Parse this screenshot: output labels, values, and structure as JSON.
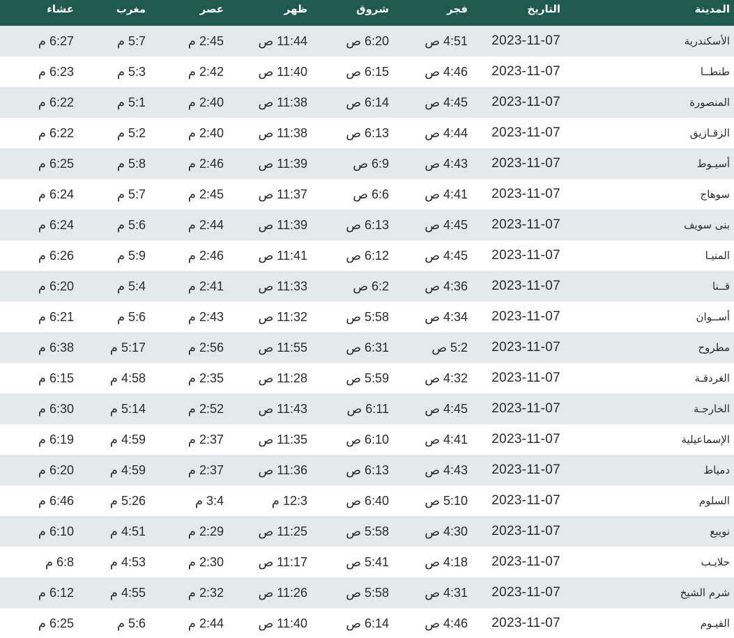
{
  "table": {
    "headers": {
      "city": "المدينة",
      "date": "التاريخ",
      "fajr": "فجر",
      "sunrise": "شروق",
      "dhuhr": "ظهر",
      "asr": "عصر",
      "maghrib": "مغرب",
      "isha": "عشاء"
    },
    "rows": [
      {
        "city": "الأسكندرية",
        "date": "2023-11-07",
        "fajr": "4:51 ص",
        "sunrise": "6:20 ص",
        "dhuhr": "11:44 ص",
        "asr": "2:45 م",
        "maghrib": "5:7 م",
        "isha": "6:27 م"
      },
      {
        "city": "طنطــا",
        "date": "2023-11-07",
        "fajr": "4:46 ص",
        "sunrise": "6:15 ص",
        "dhuhr": "11:40 ص",
        "asr": "2:42 م",
        "maghrib": "5:3 م",
        "isha": "6:23 م"
      },
      {
        "city": "المنصورة",
        "date": "2023-11-07",
        "fajr": "4:45 ص",
        "sunrise": "6:14 ص",
        "dhuhr": "11:38 ص",
        "asr": "2:40 م",
        "maghrib": "5:1 م",
        "isha": "6:22 م"
      },
      {
        "city": "الزقـازيق",
        "date": "2023-11-07",
        "fajr": "4:44 ص",
        "sunrise": "6:13 ص",
        "dhuhr": "11:38 ص",
        "asr": "2:40 م",
        "maghrib": "5:2 م",
        "isha": "6:22 م"
      },
      {
        "city": "أسيـوط",
        "date": "2023-11-07",
        "fajr": "4:43 ص",
        "sunrise": "6:9 ص",
        "dhuhr": "11:39 ص",
        "asr": "2:46 م",
        "maghrib": "5:8 م",
        "isha": "6:25 م"
      },
      {
        "city": "سوهاج",
        "date": "2023-11-07",
        "fajr": "4:41 ص",
        "sunrise": "6:6 ص",
        "dhuhr": "11:37 ص",
        "asr": "2:45 م",
        "maghrib": "5:7 م",
        "isha": "6:24 م"
      },
      {
        "city": "بنى سويف",
        "date": "2023-11-07",
        "fajr": "4:45 ص",
        "sunrise": "6:13 ص",
        "dhuhr": "11:39 ص",
        "asr": "2:44 م",
        "maghrib": "5:6 م",
        "isha": "6:24 م"
      },
      {
        "city": "المنيـا",
        "date": "2023-11-07",
        "fajr": "4:45 ص",
        "sunrise": "6:12 ص",
        "dhuhr": "11:41 ص",
        "asr": "2:46 م",
        "maghrib": "5:9 م",
        "isha": "6:26 م"
      },
      {
        "city": "قــنا",
        "date": "2023-11-07",
        "fajr": "4:36 ص",
        "sunrise": "6:2 ص",
        "dhuhr": "11:33 ص",
        "asr": "2:41 م",
        "maghrib": "5:4 م",
        "isha": "6:20 م"
      },
      {
        "city": "أســوان",
        "date": "2023-11-07",
        "fajr": "4:34 ص",
        "sunrise": "5:58 ص",
        "dhuhr": "11:32 ص",
        "asr": "2:43 م",
        "maghrib": "5:6 م",
        "isha": "6:21 م"
      },
      {
        "city": "مطروح",
        "date": "2023-11-07",
        "fajr": "5:2 ص",
        "sunrise": "6:31 ص",
        "dhuhr": "11:55 ص",
        "asr": "2:56 م",
        "maghrib": "5:17 م",
        "isha": "6:38 م"
      },
      {
        "city": "الغردقـة",
        "date": "2023-11-07",
        "fajr": "4:32 ص",
        "sunrise": "5:59 ص",
        "dhuhr": "11:28 ص",
        "asr": "2:35 م",
        "maghrib": "4:58 م",
        "isha": "6:15 م"
      },
      {
        "city": "الخارجـة",
        "date": "2023-11-07",
        "fajr": "4:45 ص",
        "sunrise": "6:11 ص",
        "dhuhr": "11:43 ص",
        "asr": "2:52 م",
        "maghrib": "5:14 م",
        "isha": "6:30 م"
      },
      {
        "city": "الإسماعيلية",
        "date": "2023-11-07",
        "fajr": "4:41 ص",
        "sunrise": "6:10 ص",
        "dhuhr": "11:35 ص",
        "asr": "2:37 م",
        "maghrib": "4:59 م",
        "isha": "6:19 م"
      },
      {
        "city": "دمياط",
        "date": "2023-11-07",
        "fajr": "4:43 ص",
        "sunrise": "6:13 ص",
        "dhuhr": "11:36 ص",
        "asr": "2:37 م",
        "maghrib": "4:59 م",
        "isha": "6:20 م"
      },
      {
        "city": "السلوم",
        "date": "2023-11-07",
        "fajr": "5:10 ص",
        "sunrise": "6:40 ص",
        "dhuhr": "12:3 م",
        "asr": "3:4 م",
        "maghrib": "5:26 م",
        "isha": "6:46 م"
      },
      {
        "city": "نويبع",
        "date": "2023-11-07",
        "fajr": "4:30 ص",
        "sunrise": "5:58 ص",
        "dhuhr": "11:25 ص",
        "asr": "2:29 م",
        "maghrib": "4:51 م",
        "isha": "6:10 م"
      },
      {
        "city": "حلايـب",
        "date": "2023-11-07",
        "fajr": "4:18 ص",
        "sunrise": "5:41 ص",
        "dhuhr": "11:17 ص",
        "asr": "2:30 م",
        "maghrib": "4:53 م",
        "isha": "6:8 م"
      },
      {
        "city": "شرم الشيخ",
        "date": "2023-11-07",
        "fajr": "4:31 ص",
        "sunrise": "5:58 ص",
        "dhuhr": "11:26 ص",
        "asr": "2:32 م",
        "maghrib": "4:55 م",
        "isha": "6:12 م"
      },
      {
        "city": "الفيـوم",
        "date": "2023-11-07",
        "fajr": "4:46 ص",
        "sunrise": "6:14 ص",
        "dhuhr": "11:40 ص",
        "asr": "2:44 م",
        "maghrib": "5:6 م",
        "isha": "6:25 م"
      }
    ]
  },
  "colors": {
    "header_bg": "#1e5a4f",
    "header_text": "#ffffff",
    "row_alt_bg": "#e3eaeb",
    "row_bg": "#ffffff"
  }
}
